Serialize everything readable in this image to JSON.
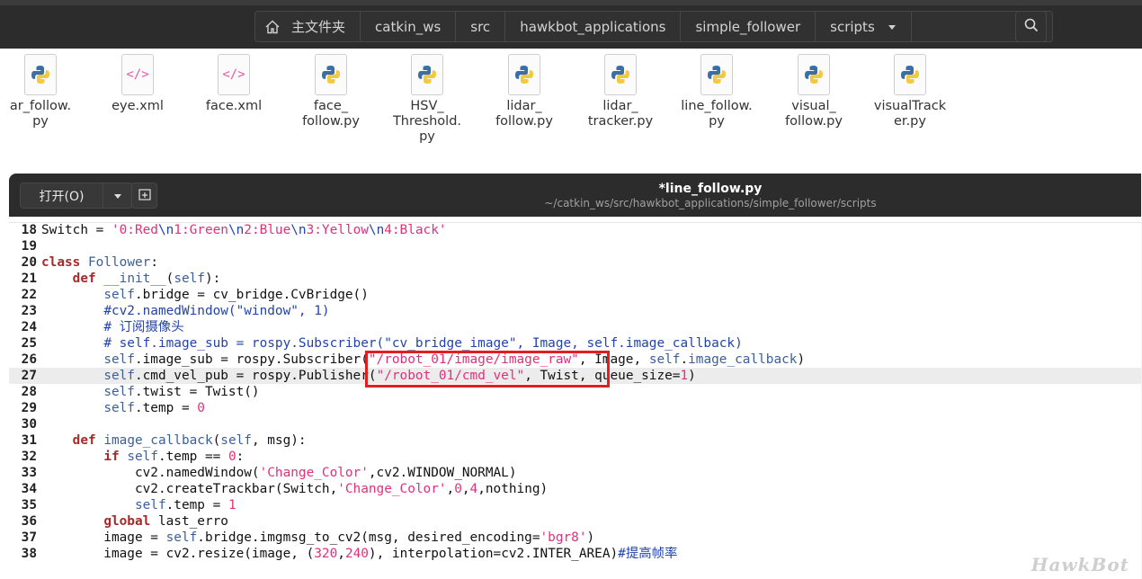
{
  "file_manager": {
    "breadcrumbs": [
      "主文件夹",
      "catkin_ws",
      "src",
      "hawkbot_applications",
      "simple_follower",
      "scripts"
    ],
    "files": [
      {
        "name": "ar_follow.\npy",
        "type": "python"
      },
      {
        "name": "eye.xml",
        "type": "xml"
      },
      {
        "name": "face.xml",
        "type": "xml"
      },
      {
        "name": "face_\nfollow.py",
        "type": "python"
      },
      {
        "name": "HSV_\nThreshold.\npy",
        "type": "python"
      },
      {
        "name": "lidar_\nfollow.py",
        "type": "python"
      },
      {
        "name": "lidar_\ntracker.py",
        "type": "python"
      },
      {
        "name": "line_follow.\npy",
        "type": "python"
      },
      {
        "name": "visual_\nfollow.py",
        "type": "python"
      },
      {
        "name": "visualTrack\ner.py",
        "type": "python"
      }
    ],
    "icons": {
      "home": "home-icon",
      "search": "search-icon",
      "python": "python-file-icon",
      "xml": "xml-file-icon"
    }
  },
  "editor": {
    "open_label": "打开(O)",
    "title": "*line_follow.py",
    "path": "~/catkin_ws/src/hawkbot_applications/simple_follower/scripts",
    "current_line": 27,
    "lines": [
      {
        "n": "18",
        "code": "Switch = '0:Red\\n1:Green\\n2:Blue\\n3:Yellow\\n4:Black'"
      },
      {
        "n": "19",
        "code": ""
      },
      {
        "n": "20",
        "code": "class Follower:"
      },
      {
        "n": "21",
        "code": "    def __init__(self):"
      },
      {
        "n": "22",
        "code": "        self.bridge = cv_bridge.CvBridge()"
      },
      {
        "n": "23",
        "code": "        #cv2.namedWindow(\"window\", 1)"
      },
      {
        "n": "24",
        "code": "        # 订阅摄像头"
      },
      {
        "n": "25",
        "code": "        # self.image_sub = rospy.Subscriber(\"cv_bridge_image\", Image, self.image_callback)"
      },
      {
        "n": "26",
        "code": "        self.image_sub = rospy.Subscriber(\"/robot_01/image/image_raw\", Image, self.image_callback)"
      },
      {
        "n": "27",
        "code": "        self.cmd_vel_pub = rospy.Publisher(\"/robot_01/cmd_vel\", Twist, queue_size=1)"
      },
      {
        "n": "28",
        "code": "        self.twist = Twist()"
      },
      {
        "n": "29",
        "code": "        self.temp = 0"
      },
      {
        "n": "30",
        "code": ""
      },
      {
        "n": "31",
        "code": "    def image_callback(self, msg):"
      },
      {
        "n": "32",
        "code": "        if self.temp == 0:"
      },
      {
        "n": "33",
        "code": "            cv2.namedWindow('Change_Color',cv2.WINDOW_NORMAL)"
      },
      {
        "n": "34",
        "code": "            cv2.createTrackbar(Switch,'Change_Color',0,4,nothing)"
      },
      {
        "n": "35",
        "code": "            self.temp = 1"
      },
      {
        "n": "36",
        "code": "        global last_erro"
      },
      {
        "n": "37",
        "code": "        image = self.bridge.imgmsg_to_cv2(msg, desired_encoding='bgr8')"
      },
      {
        "n": "38",
        "code": "        image = cv2.resize(image, (320,240), interpolation=cv2.INTER_AREA)#提高帧率"
      }
    ]
  },
  "watermark": "HawkBot",
  "colors": {
    "highlight_box": "#e02020",
    "toolbar": "#2c2c2c",
    "keyword": "#a52a2a",
    "string": "#e0307a"
  }
}
